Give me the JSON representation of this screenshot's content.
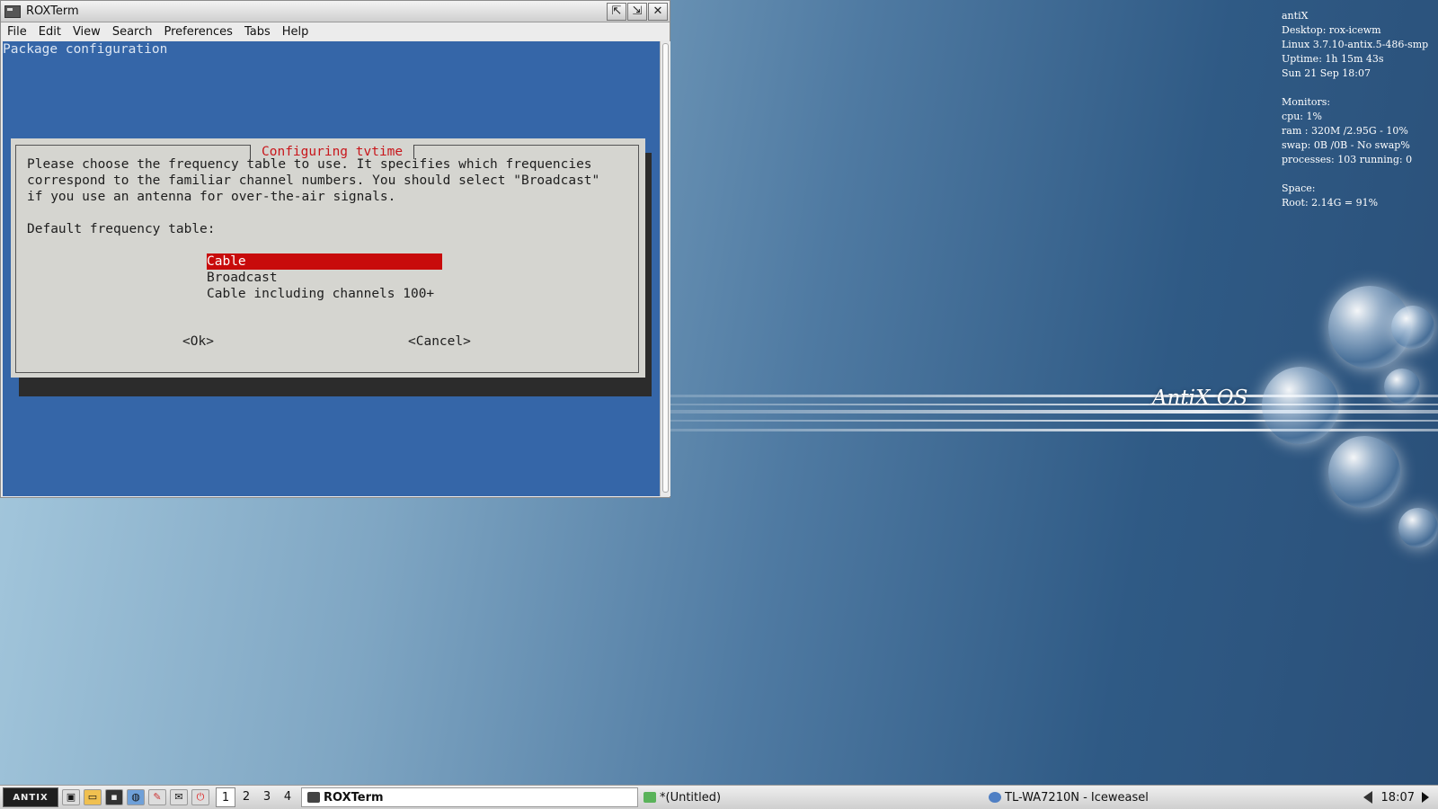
{
  "window": {
    "title": "ROXTerm",
    "menus": [
      "File",
      "Edit",
      "View",
      "Search",
      "Preferences",
      "Tabs",
      "Help"
    ],
    "controls": [
      "⇱",
      "⇲",
      "✕"
    ]
  },
  "terminal": {
    "header": "Package configuration",
    "dialog": {
      "title": "Configuring tvtime",
      "lines": [
        "Please choose the frequency table to use. It specifies which frequencies",
        "correspond to the familiar channel numbers. You should select \"Broadcast\"",
        "if you use an antenna for over-the-air signals."
      ],
      "prompt": "Default frequency table:",
      "options": [
        "Cable",
        "Broadcast",
        "Cable including channels 100+"
      ],
      "selected_option": "Cable",
      "ok_label": "<Ok>",
      "cancel_label": "<Cancel>"
    }
  },
  "conky": {
    "host": "antiX",
    "desktop": "Desktop: rox-icewm",
    "kernel": "Linux 3.7.10-antix.5-486-smp",
    "uptime": "Uptime: 1h 15m 43s",
    "date": "Sun 21 Sep 18:07",
    "monitors_label": "Monitors:",
    "cpu": "cpu: 1%",
    "ram": "ram : 320M /2.95G - 10%",
    "swap": "swap: 0B  /0B   - No swap%",
    "processes": "processes: 103  running: 0",
    "space_label": "Space:",
    "root": "Root: 2.14G = 91%"
  },
  "wallpaper": {
    "logo": "AntiX OS"
  },
  "taskbar": {
    "start_label": "ANTIX",
    "workspaces": [
      "1",
      "2",
      "3",
      "4"
    ],
    "active_workspace": "1",
    "tasks": [
      "ROXTerm",
      "*(Untitled)",
      "TL-WA7210N - Iceweasel"
    ],
    "clock": "18:07"
  },
  "colors": {
    "terminal_bg": "#3566a8",
    "dialog_bg": "#d5d5d0",
    "selection": "#c80b0b",
    "dialog_title": "#c8161b"
  }
}
